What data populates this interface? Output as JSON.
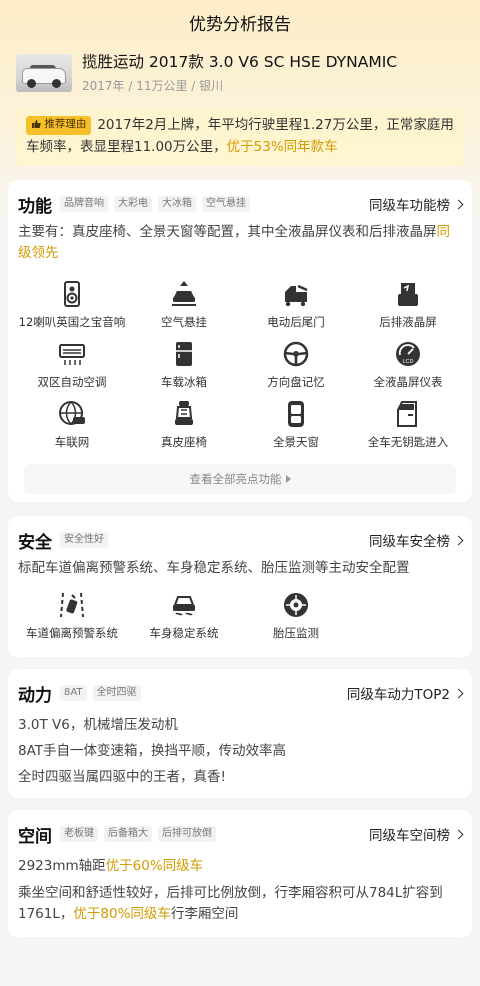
{
  "header": {
    "title": "优势分析报告"
  },
  "car": {
    "name": "揽胜运动 2017款 3.0 V6 SC HSE DYNAMIC",
    "meta": "2017年 / 11万公里 / 银川"
  },
  "reason": {
    "tag": "推荐理由",
    "text": "2017年2月上牌，年平均行驶里程1.27万公里，正常家庭用车频率，表显里程11.00万公里，",
    "highlight": "优于53%同年款车"
  },
  "function": {
    "title": "功能",
    "chips": [
      "品牌音响",
      "大彩电",
      "大冰箱",
      "空气悬挂"
    ],
    "rank": "同级车功能榜",
    "desc_main": "主要有：真皮座椅、全景天窗等配置，其中全液晶屏仪表和后排液晶屏",
    "desc_hl": "同级领先",
    "items": [
      {
        "label": "12喇叭英国之宝音响",
        "icon": "speaker-icon"
      },
      {
        "label": "空气悬挂",
        "icon": "air-suspension-icon"
      },
      {
        "label": "电动后尾门",
        "icon": "power-tailgate-icon"
      },
      {
        "label": "后排液晶屏",
        "icon": "rear-screen-icon"
      },
      {
        "label": "双区自动空调",
        "icon": "dual-zone-ac-icon"
      },
      {
        "label": "车载冰箱",
        "icon": "fridge-icon"
      },
      {
        "label": "方向盘记忆",
        "icon": "steering-memory-icon"
      },
      {
        "label": "全液晶屏仪表",
        "icon": "lcd-cluster-icon"
      },
      {
        "label": "车联网",
        "icon": "connected-car-icon"
      },
      {
        "label": "真皮座椅",
        "icon": "leather-seat-icon"
      },
      {
        "label": "全景天窗",
        "icon": "panoramic-roof-icon"
      },
      {
        "label": "全车无钥匙进入",
        "icon": "keyless-entry-icon"
      }
    ],
    "more": "查看全部亮点功能"
  },
  "safety": {
    "title": "安全",
    "chips": [
      "安全性好"
    ],
    "rank": "同级车安全榜",
    "desc": "标配车道偏离预警系统、车身稳定系统、胎压监测等主动安全配置",
    "items": [
      {
        "label": "车道偏离预警系统",
        "icon": "lane-departure-icon"
      },
      {
        "label": "车身稳定系统",
        "icon": "stability-control-icon"
      },
      {
        "label": "胎压监测",
        "icon": "tire-pressure-icon"
      }
    ]
  },
  "power": {
    "title": "动力",
    "chips": [
      "8AT",
      "全时四驱"
    ],
    "rank": "同级车动力TOP2",
    "lines": [
      "3.0T V6，机械增压发动机",
      "8AT手自一体变速箱，换挡平顺，传动效率高",
      "全时四驱当属四驱中的王者，真香!"
    ]
  },
  "space": {
    "title": "空间",
    "chips": [
      "老板键",
      "后备箱大",
      "后排可放倒"
    ],
    "rank": "同级车空间榜",
    "line1": "2923mm轴距",
    "line1_hl": "优于60%同级车",
    "line2a": "乘坐空间和舒适性较好，后排可比例放倒，行李厢容积可从784L扩容到1761L，",
    "line2_hl": "优于80%同级车",
    "line2b": "行李厢空间"
  },
  "colors": {
    "highlight": "#d29b00",
    "tag_bg": "#f6c02a",
    "icon": "#333333"
  }
}
